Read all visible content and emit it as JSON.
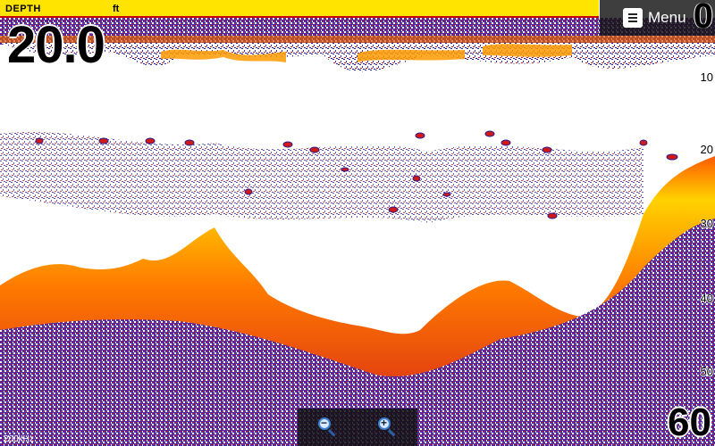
{
  "depth_display": {
    "label": "DEPTH",
    "unit": "ft",
    "value": "20.0"
  },
  "menu": {
    "label": "Menu",
    "icon": "list-icon"
  },
  "scale": {
    "top": "0",
    "ticks": [
      "10",
      "20",
      "30",
      "40",
      "50"
    ],
    "bottom": "60"
  },
  "frequency": "200kHz",
  "zoom": {
    "out_icon": "zoom-out-icon",
    "in_icon": "zoom-in-icon"
  },
  "colors": {
    "depth_bar": "#ffe400",
    "sonar_strong": "#ffcc00",
    "sonar_mid": "#e03000",
    "sonar_weak": "#2a1a8c",
    "background": "#ffffff"
  }
}
